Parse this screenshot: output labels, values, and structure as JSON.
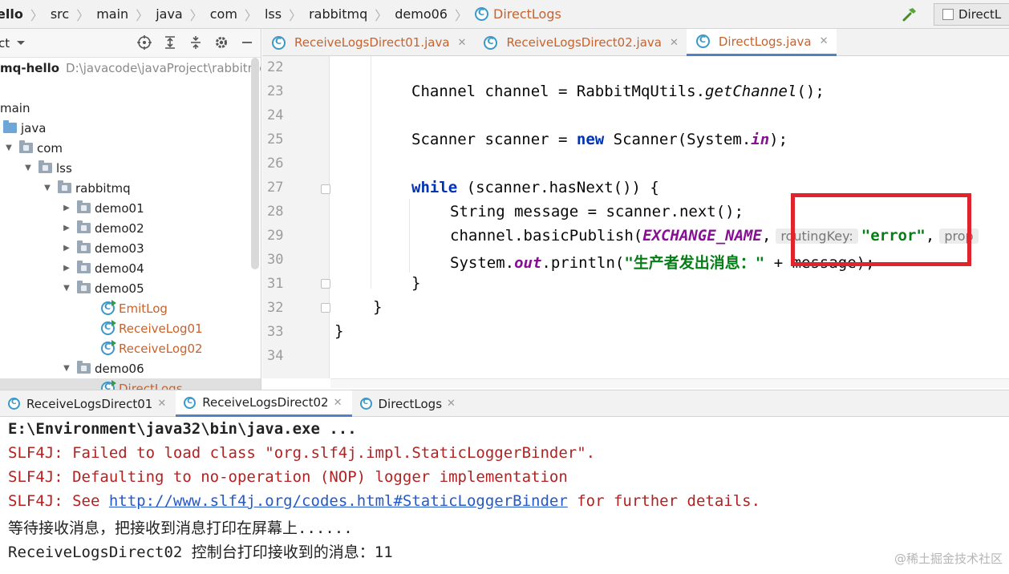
{
  "breadcrumb": {
    "items": [
      "ello",
      "src",
      "main",
      "java",
      "com",
      "lss",
      "rabbitmq",
      "demo06",
      "DirectLogs"
    ]
  },
  "toolbar": {
    "run_config_label": "DirectL",
    "build_icon": "hammer-icon"
  },
  "project_panel": {
    "title": "ct",
    "tree": [
      {
        "label": "mq-hello",
        "path": "D:\\javacode\\javaProject\\rabbitmq-",
        "kind": "module"
      },
      {
        "label": "main",
        "kind": "text"
      },
      {
        "label": "java",
        "kind": "src-folder"
      },
      {
        "label": "com",
        "kind": "folder"
      },
      {
        "label": "lss",
        "kind": "folder"
      },
      {
        "label": "rabbitmq",
        "kind": "folder"
      },
      {
        "label": "demo01",
        "kind": "folder"
      },
      {
        "label": "demo02",
        "kind": "folder"
      },
      {
        "label": "demo03",
        "kind": "folder"
      },
      {
        "label": "demo04",
        "kind": "folder"
      },
      {
        "label": "demo05",
        "kind": "folder"
      },
      {
        "label": "EmitLog",
        "kind": "class"
      },
      {
        "label": "ReceiveLog01",
        "kind": "class"
      },
      {
        "label": "ReceiveLog02",
        "kind": "class"
      },
      {
        "label": "demo06",
        "kind": "folder"
      },
      {
        "label": "DirectLogs",
        "kind": "class"
      }
    ]
  },
  "editor": {
    "tabs": [
      {
        "label": "ReceiveLogsDirect01.java",
        "active": false
      },
      {
        "label": "ReceiveLogsDirect02.java",
        "active": false
      },
      {
        "label": "DirectLogs.java",
        "active": true
      }
    ],
    "line_numbers": [
      "22",
      "23",
      "24",
      "25",
      "26",
      "27",
      "28",
      "29",
      "30",
      "31",
      "32",
      "33",
      "34"
    ],
    "code": {
      "l23_a": "Channel channel = RabbitMqUtils.",
      "l23_b": "getChannel",
      "l23_c": "();",
      "l25_a": "Scanner scanner = ",
      "l25_kw": "new",
      "l25_b": " Scanner(System.",
      "l25_c": "in",
      "l25_d": ");",
      "l27_kw": "while",
      "l27_a": " (scanner.hasNext()) {",
      "l28": "String message = scanner.next();",
      "l29_a": "channel.basicPublish(",
      "l29_b": "EXCHANGE_NAME",
      "l29_c": ",",
      "l29_hint1": "routingKey:",
      "l29_str": "\"error\"",
      "l29_d": ",",
      "l29_hint2": "prop",
      "l30_a": "System.",
      "l30_b": "out",
      "l30_c": ".println(",
      "l30_str": "\"生产者发出消息：\"",
      "l30_d": " + message);",
      "l31": "}",
      "l32": "}",
      "l33": "}"
    }
  },
  "run_panel": {
    "tabs": [
      {
        "label": "ReceiveLogsDirect01",
        "active": false
      },
      {
        "label": "ReceiveLogsDirect02",
        "active": true
      },
      {
        "label": "DirectLogs",
        "active": false
      }
    ],
    "console": {
      "cmd": "E:\\Environment\\java32\\bin\\java.exe ...",
      "err1": "SLF4J: Failed to load class \"org.slf4j.impl.StaticLoggerBinder\".",
      "err2": "SLF4J: Defaulting to no-operation (NOP) logger implementation",
      "err3_a": "SLF4J: See ",
      "err3_link": "http://www.slf4j.org/codes.html#StaticLoggerBinder",
      "err3_b": " for further details.",
      "out1": "等待接收消息，把接收到消息打印在屏幕上......",
      "out2": "ReceiveLogsDirect02 控制台打印接收到的消息：11"
    }
  },
  "watermark": "@稀土掘金技术社区",
  "colors": {
    "highlight_box": "#e0232d",
    "keyword": "#0033b3",
    "string": "#067d17",
    "constant": "#871094",
    "error_text": "#b22222",
    "link": "#2459c8",
    "class_name": "#c8622c"
  }
}
